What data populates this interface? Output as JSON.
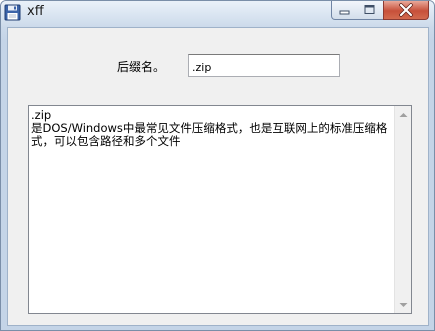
{
  "window": {
    "title": "xff"
  },
  "form": {
    "suffix_label": "后缀名。",
    "suffix_value": ".zip"
  },
  "description": {
    "text": ".zip\n是DOS/Windows中最常见文件压缩格式，也是互联网上的标准压缩格式，可以包含路径和多个文件"
  },
  "icons": {
    "app": "floppy-disk-icon",
    "minimize": "minimize-icon",
    "maximize": "maximize-icon",
    "close": "close-icon",
    "scroll_up": "scroll-up-arrow-icon",
    "scroll_down": "scroll-down-arrow-icon"
  },
  "colors": {
    "close_button": "#c7503a",
    "window_frame": "#c4d4e7",
    "client_bg": "#f0f0f0"
  }
}
